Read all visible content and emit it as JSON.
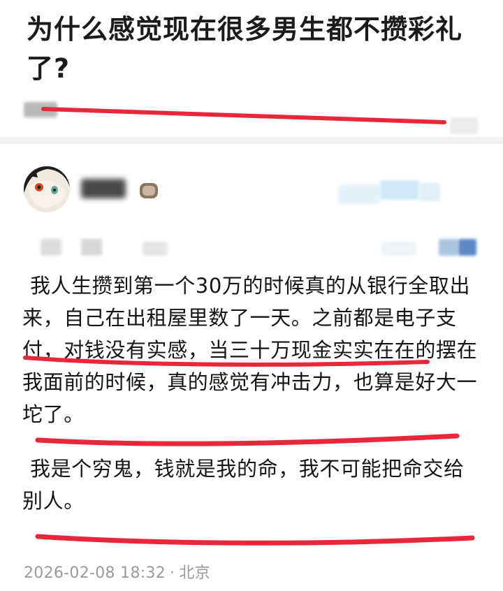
{
  "question": {
    "title": "为什么感觉现在很多男生都不攒彩礼了?"
  },
  "answer": {
    "author": {
      "avatar_icon": "cat-cartoon-avatar-icon",
      "badge_icon": "badge-icon"
    },
    "paragraphs": [
      "我人生攒到第一个30万的时候真的从银行全取出来，自己在出租屋里数了一天。之前都是电子支付，对钱没有实感，当三十万现金实实在在的摆在我面前的时候，真的感觉有冲击力，也算是好大一坨了。",
      "我是个穷鬼，钱就是我的命，我不可能把命交给别人。"
    ],
    "meta": {
      "datetime": "2026-02-08 18:32",
      "separator": "·",
      "location": "北京"
    }
  },
  "colors": {
    "annotation_red": "#e8283a",
    "meta_gray": "#9a9a9a",
    "divider": "#f2f2f2"
  }
}
